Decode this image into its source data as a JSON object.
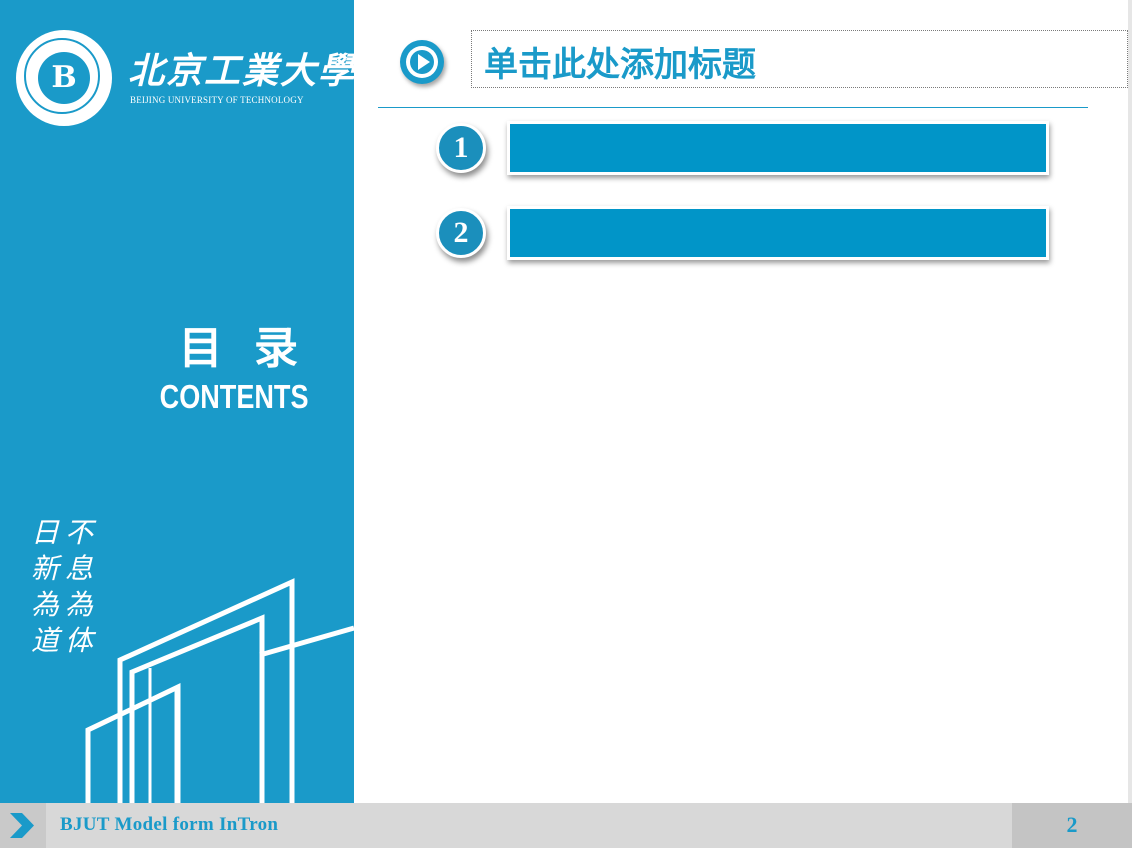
{
  "logo": {
    "seal_letter": "B",
    "name_cn": "北京工業大學",
    "name_en": "BEIJING UNIVERSITY OF TECHNOLOGY"
  },
  "toc": {
    "title": "目 录",
    "subtitle": "CONTENTS"
  },
  "motto": {
    "column1": "不息為体",
    "column2": "日新為道"
  },
  "header": {
    "title": "单击此处添加标题"
  },
  "items": [
    {
      "number": "1",
      "text": ""
    },
    {
      "number": "2",
      "text": ""
    }
  ],
  "footer": {
    "text": "BJUT Model form InTron",
    "page_number": "2"
  },
  "colors": {
    "accent": "#1a9ac9",
    "bar": "#0195c8",
    "footer_bg": "#d8d8d8"
  }
}
